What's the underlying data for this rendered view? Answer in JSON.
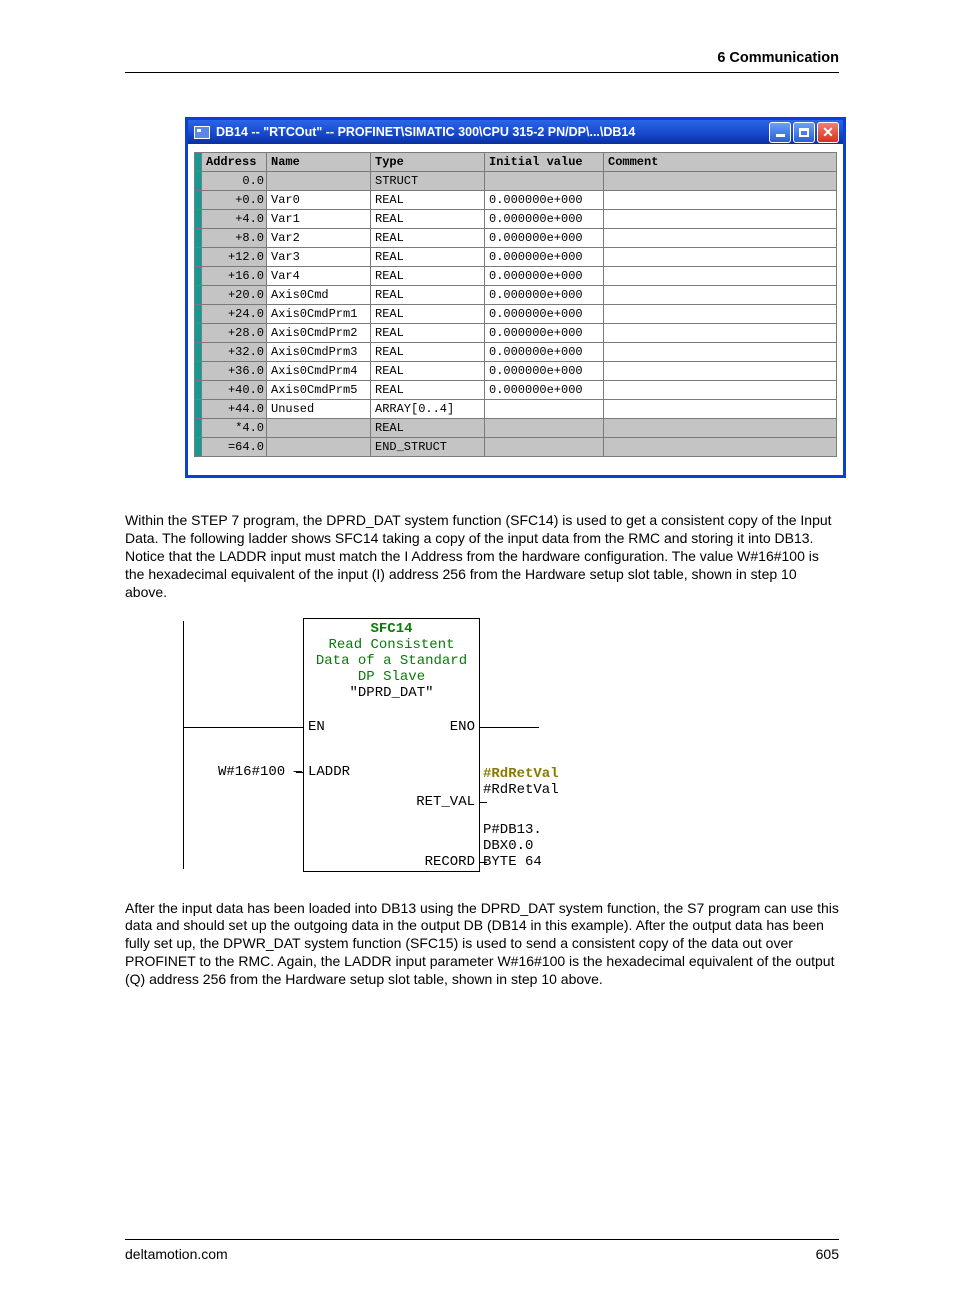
{
  "header": {
    "section": "6  Communication"
  },
  "window": {
    "title": "DB14 -- \"RTCOut\" -- PROFINET\\SIMATIC 300\\CPU 315-2 PN/DP\\...\\DB14",
    "columns": [
      "Address",
      "Name",
      "Type",
      "Initial value",
      "Comment"
    ],
    "rows": [
      {
        "addr": "0.0",
        "name": "",
        "type": "STRUCT",
        "init": "",
        "comment": "",
        "shade": true
      },
      {
        "addr": "+0.0",
        "name": "Var0",
        "type": "REAL",
        "init": "0.000000e+000",
        "comment": "",
        "shade": false
      },
      {
        "addr": "+4.0",
        "name": "Var1",
        "type": "REAL",
        "init": "0.000000e+000",
        "comment": "",
        "shade": false
      },
      {
        "addr": "+8.0",
        "name": "Var2",
        "type": "REAL",
        "init": "0.000000e+000",
        "comment": "",
        "shade": false
      },
      {
        "addr": "+12.0",
        "name": "Var3",
        "type": "REAL",
        "init": "0.000000e+000",
        "comment": "",
        "shade": false
      },
      {
        "addr": "+16.0",
        "name": "Var4",
        "type": "REAL",
        "init": "0.000000e+000",
        "comment": "",
        "shade": false
      },
      {
        "addr": "+20.0",
        "name": "Axis0Cmd",
        "type": "REAL",
        "init": "0.000000e+000",
        "comment": "",
        "shade": false
      },
      {
        "addr": "+24.0",
        "name": "Axis0CmdPrm1",
        "type": "REAL",
        "init": "0.000000e+000",
        "comment": "",
        "shade": false
      },
      {
        "addr": "+28.0",
        "name": "Axis0CmdPrm2",
        "type": "REAL",
        "init": "0.000000e+000",
        "comment": "",
        "shade": false
      },
      {
        "addr": "+32.0",
        "name": "Axis0CmdPrm3",
        "type": "REAL",
        "init": "0.000000e+000",
        "comment": "",
        "shade": false
      },
      {
        "addr": "+36.0",
        "name": "Axis0CmdPrm4",
        "type": "REAL",
        "init": "0.000000e+000",
        "comment": "",
        "shade": false
      },
      {
        "addr": "+40.0",
        "name": "Axis0CmdPrm5",
        "type": "REAL",
        "init": "0.000000e+000",
        "comment": "",
        "shade": false
      },
      {
        "addr": "+44.0",
        "name": "Unused",
        "type": "ARRAY[0..4]",
        "init": "",
        "comment": "",
        "shade": false
      },
      {
        "addr": "*4.0",
        "name": "",
        "type": "REAL",
        "init": "",
        "comment": "",
        "shade": true
      },
      {
        "addr": "=64.0",
        "name": "",
        "type": "END_STRUCT",
        "init": "",
        "comment": "",
        "shade": true
      }
    ]
  },
  "paragraph1": "Within the STEP 7 program, the DPRD_DAT system function (SFC14) is used to get a consistent copy of the Input Data. The following ladder shows SFC14 taking a copy of the input data from the RMC and storing it into DB13. Notice that the LADDR input must match the I Address from the hardware configuration. The value W#16#100 is the hexadecimal equivalent of the input (I) address 256 from the Hardware setup slot table, shown in step 10 above.",
  "ladder": {
    "block_id": "SFC14",
    "block_sub1": "Read Consistent",
    "block_sub2": "Data of a Standard",
    "block_sub3": "DP Slave",
    "block_name": "\"DPRD_DAT\"",
    "en": "EN",
    "eno": "ENO",
    "laddr_label": "LADDR",
    "laddr_value": "W#16#100",
    "retval_label": "RET_VAL",
    "retval_out_hl": "#RdRetVal",
    "retval_out": "#RdRetVal",
    "record_label": "RECORD",
    "record_out1": "P#DB13.",
    "record_out2": "DBX0.0",
    "record_out3": "BYTE 64"
  },
  "paragraph2": "After the input data has been loaded into DB13 using the DPRD_DAT system function, the S7 program can use this data and should set up the outgoing data in the output DB (DB14 in this example). After the output data has been fully set up, the DPWR_DAT system function (SFC15) is used to send a consistent copy of the data out over PROFINET to the RMC. Again, the LADDR input parameter W#16#100 is the hexadecimal equivalent of the output (Q) address 256 from the Hardware setup slot table, shown in step 10 above.",
  "footer": {
    "left": "deltamotion.com",
    "right": "605"
  }
}
